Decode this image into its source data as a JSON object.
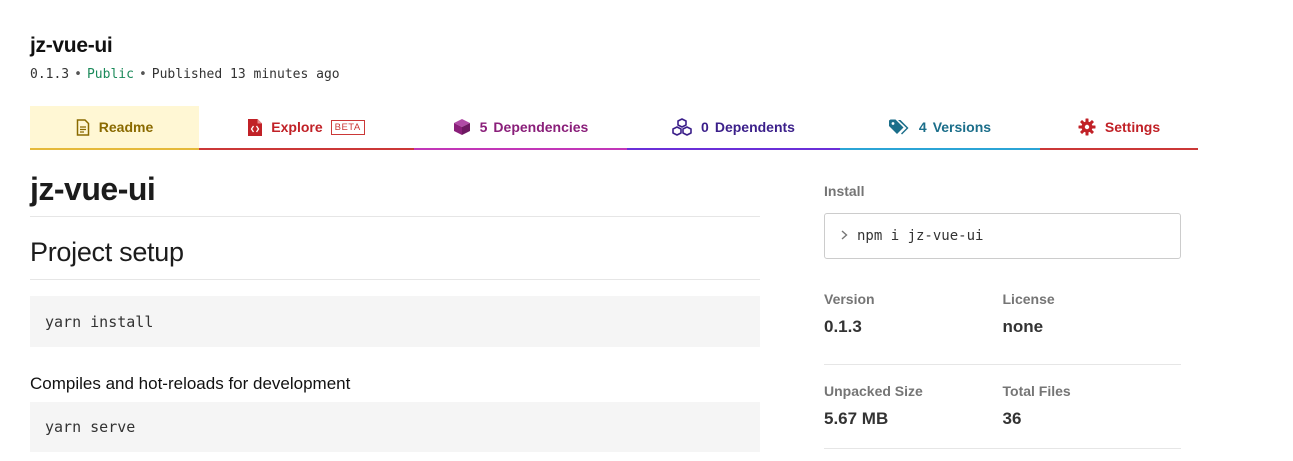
{
  "package": {
    "name": "jz-vue-ui",
    "version": "0.1.3",
    "visibility": "Public",
    "published": "Published 13 minutes ago"
  },
  "tabs": {
    "readme": {
      "label": "Readme"
    },
    "explore": {
      "label": "Explore",
      "badge": "BETA"
    },
    "dependencies": {
      "count": "5",
      "label": "Dependencies"
    },
    "dependents": {
      "count": "0",
      "label": "Dependents"
    },
    "versions": {
      "count": "4",
      "label": "Versions"
    },
    "settings": {
      "label": "Settings"
    }
  },
  "readme": {
    "title": "jz-vue-ui",
    "h2": "Project setup",
    "code1": "yarn install",
    "h3": "Compiles and hot-reloads for development",
    "code2": "yarn serve"
  },
  "sidebar": {
    "install_label": "Install",
    "install_command": "npm i jz-vue-ui",
    "version_label": "Version",
    "version_value": "0.1.3",
    "license_label": "License",
    "license_value": "none",
    "unpacked_label": "Unpacked Size",
    "unpacked_value": "5.67 MB",
    "files_label": "Total Files",
    "files_value": "36"
  },
  "colors": {
    "readme": "#8a6a00",
    "explore": "#c12127",
    "dependencies": "#8a1f7a",
    "dependents": "#3b1f8a",
    "versions": "#1b6e8a",
    "settings": "#c12127",
    "public": "#1b8a5a"
  },
  "icons": {
    "readme": "document-icon",
    "explore": "file-code-icon",
    "dependencies": "box-icon",
    "dependents": "boxes-icon",
    "versions": "tags-icon",
    "settings": "gear-icon",
    "install": "chevron-right-icon"
  }
}
